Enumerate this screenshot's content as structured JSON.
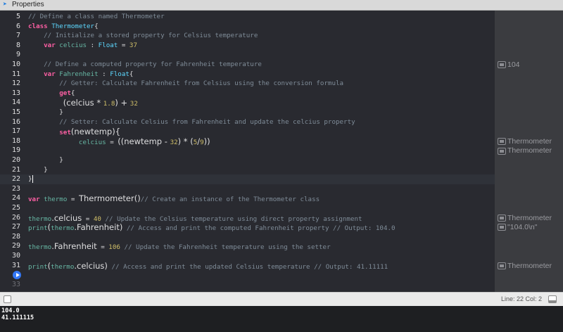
{
  "window": {
    "title": "Properties"
  },
  "editor": {
    "lines": [
      {
        "n": "5",
        "segs": [
          [
            "cm",
            "// Define a class named Thermometer"
          ]
        ]
      },
      {
        "n": "6",
        "segs": [
          [
            "kw",
            "class"
          ],
          [
            "",
            " "
          ],
          [
            "ty",
            "Thermometer"
          ],
          [
            "",
            "{"
          ]
        ]
      },
      {
        "n": "7",
        "segs": [
          [
            "",
            "    "
          ],
          [
            "cm",
            "// Initialize a stored property for Celsius temperature"
          ]
        ]
      },
      {
        "n": "8",
        "segs": [
          [
            "",
            "    "
          ],
          [
            "kw",
            "var"
          ],
          [
            "",
            " "
          ],
          [
            "id",
            "celcius"
          ],
          [
            "",
            " : "
          ],
          [
            "ty",
            "Float"
          ],
          [
            "",
            " = "
          ],
          [
            "num",
            "37"
          ]
        ]
      },
      {
        "n": "9",
        "segs": []
      },
      {
        "n": "10",
        "segs": [
          [
            "",
            "    "
          ],
          [
            "cm",
            "// Define a computed property for Fahrenheit temperature"
          ]
        ]
      },
      {
        "n": "11",
        "segs": [
          [
            "",
            "    "
          ],
          [
            "kw",
            "var"
          ],
          [
            "",
            " "
          ],
          [
            "id",
            "Fahrenheit"
          ],
          [
            "",
            " : "
          ],
          [
            "ty",
            "Float"
          ],
          [
            "",
            "{"
          ]
        ]
      },
      {
        "n": "12",
        "segs": [
          [
            "",
            "        "
          ],
          [
            "cm",
            "// Getter: Calculate Fahrenheit from Celsius using the conversion formula"
          ]
        ]
      },
      {
        "n": "13",
        "segs": [
          [
            "",
            "        "
          ],
          [
            "kw",
            "get"
          ],
          [
            "",
            "{"
          ]
        ]
      },
      {
        "n": "14",
        "segs": [
          [
            "",
            "         "
          ],
          [
            "big",
            "(celcius * "
          ],
          [
            "num",
            "1.8"
          ],
          [
            "big",
            ") + "
          ],
          [
            "num",
            "32"
          ]
        ]
      },
      {
        "n": "15",
        "segs": [
          [
            "",
            "        }"
          ]
        ]
      },
      {
        "n": "16",
        "segs": [
          [
            "",
            "        "
          ],
          [
            "cm",
            "// Setter: Calculate Celsius from Fahrenheit and update the celcius property"
          ]
        ]
      },
      {
        "n": "17",
        "segs": [
          [
            "",
            "        "
          ],
          [
            "kw",
            "set"
          ],
          [
            "big",
            "(newtemp){"
          ]
        ]
      },
      {
        "n": "18",
        "segs": [
          [
            "",
            "             "
          ],
          [
            "id",
            "celcius"
          ],
          [
            "",
            " = "
          ],
          [
            "big",
            "((newtemp - "
          ],
          [
            "num",
            "32"
          ],
          [
            "big",
            ") * ("
          ],
          [
            "num",
            "5"
          ],
          [
            "big",
            "/"
          ],
          [
            "num",
            "9"
          ],
          [
            "big",
            "))"
          ]
        ]
      },
      {
        "n": "19",
        "segs": []
      },
      {
        "n": "20",
        "segs": [
          [
            "",
            "        }"
          ]
        ]
      },
      {
        "n": "21",
        "segs": [
          [
            "",
            "    }"
          ]
        ]
      },
      {
        "n": "22",
        "segs": [
          [
            "",
            "}"
          ]
        ],
        "current": true
      },
      {
        "n": "23",
        "segs": []
      },
      {
        "n": "24",
        "segs": [
          [
            "kw",
            "var"
          ],
          [
            "",
            " "
          ],
          [
            "id",
            "thermo"
          ],
          [
            "",
            " = "
          ],
          [
            "big",
            "Thermometer()"
          ],
          [
            "cm",
            "// Create an instance of the Thermometer class"
          ]
        ]
      },
      {
        "n": "25",
        "segs": []
      },
      {
        "n": "26",
        "segs": [
          [
            "id",
            "thermo"
          ],
          [
            "big",
            ".celcius"
          ],
          [
            "",
            " = "
          ],
          [
            "num",
            "40"
          ],
          [
            "",
            " "
          ],
          [
            "cm",
            "// Update the Celsius temperature using direct property assignment"
          ]
        ]
      },
      {
        "n": "27",
        "segs": [
          [
            "id",
            "print"
          ],
          [
            "big",
            "("
          ],
          [
            "id",
            "thermo"
          ],
          [
            "big",
            ".Fahrenheit)"
          ],
          [
            "",
            " "
          ],
          [
            "cm",
            "// Access and print the computed Fahrenheit property // Output: 104.0"
          ]
        ]
      },
      {
        "n": "28",
        "segs": []
      },
      {
        "n": "29",
        "segs": [
          [
            "id",
            "thermo"
          ],
          [
            "big",
            ".Fahrenheit"
          ],
          [
            "",
            " = "
          ],
          [
            "num",
            "106"
          ],
          [
            "",
            " "
          ],
          [
            "cm",
            "// Update the Fahrenheit temperature using the setter"
          ]
        ]
      },
      {
        "n": "30",
        "segs": []
      },
      {
        "n": "31",
        "segs": [
          [
            "id",
            "print"
          ],
          [
            "big",
            "("
          ],
          [
            "id",
            "thermo"
          ],
          [
            "big",
            ".celcius)"
          ],
          [
            "",
            " "
          ],
          [
            "cm",
            "// Access and print the updated Celsius temperature // Output: 41.11111"
          ]
        ]
      },
      {
        "n": "32",
        "segs": [],
        "run": true
      },
      {
        "n": "33",
        "segs": [],
        "dim": true
      }
    ]
  },
  "results": [
    {
      "line": "10",
      "text": "104"
    },
    {
      "line": "18",
      "text": "Thermometer"
    },
    {
      "line": "19",
      "text": "Thermometer"
    },
    {
      "line": "26",
      "text": "Thermometer"
    },
    {
      "line": "27",
      "text": "\"104.0\\n\""
    },
    {
      "line": "31",
      "text": "Thermometer"
    }
  ],
  "status": {
    "position": "Line: 22  Col: 2"
  },
  "console": {
    "lines": [
      "104.0",
      "41.111115"
    ]
  },
  "colors": {
    "keyword": "#fc5fa3",
    "comment": "#7f8c98",
    "type": "#5dd8ff",
    "identifier": "#67b7a4",
    "number": "#d0bf69",
    "run": "#3478f6"
  }
}
